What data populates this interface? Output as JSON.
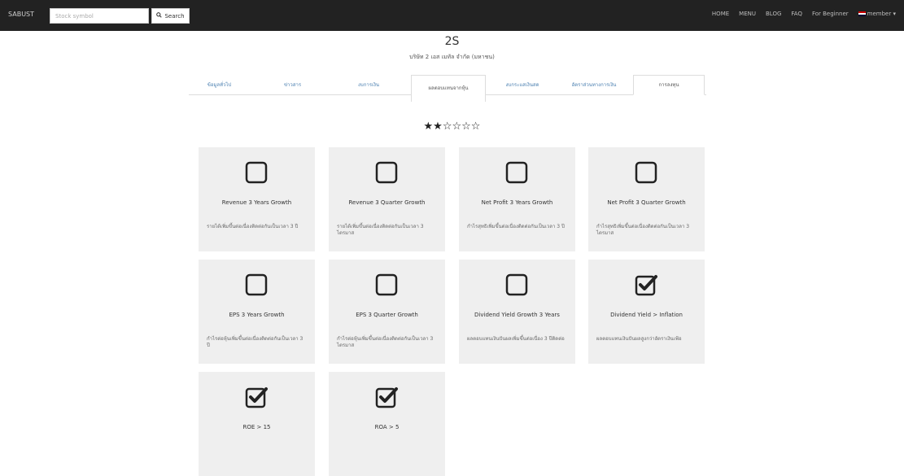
{
  "navbar": {
    "brand": "SABUST",
    "search_placeholder": "Stock symbol",
    "search_label": "Search",
    "links": [
      "HOME",
      "MENU",
      "BLOG",
      "FAQ",
      "For Beginner",
      "member"
    ]
  },
  "stock": {
    "code": "2S",
    "name": "บริษัท 2 เอส เมทัล จำกัด (มหาชน)"
  },
  "tabs": [
    "ข้อมูลทั่วไป",
    "ข่าวสาร",
    "งบการเงิน",
    "ผลตอบแทนจากหุ้น",
    "งบกระแสเงินสด",
    "อัตราส่วนทางการเงิน",
    "การลงทุน"
  ],
  "rating": {
    "filled": 1.5,
    "total": 5,
    "text": "★★☆☆☆☆"
  },
  "criteria": [
    {
      "title": "Revenue 3 Years Growth",
      "desc": "รายได้เพิ่มขึ้นต่อเนื่องติดต่อกันเป็นเวลา 3 ปี",
      "checked": false
    },
    {
      "title": "Revenue 3 Quarter Growth",
      "desc": "รายได้เพิ่มขึ้นต่อเนื่องติดต่อกันเป็นเวลา 3 ไตรมาส",
      "checked": false
    },
    {
      "title": "Net Profit 3 Years Growth",
      "desc": "กำไรสุทธิเพิ่มขึ้นต่อเนื่องติดต่อกันเป็นเวลา 3 ปี",
      "checked": false
    },
    {
      "title": "Net Profit 3 Quarter Growth",
      "desc": "กำไรสุทธิเพิ่มขึ้นต่อเนื่องติดต่อกันเป็นเวลา 3 ไตรมาส",
      "checked": false
    },
    {
      "title": "EPS 3 Years Growth",
      "desc": "กำไรต่อหุ้นเพิ่มขึ้นต่อเนื่องติดต่อกันเป็นเวลา 3 ปี",
      "checked": false
    },
    {
      "title": "EPS 3 Quarter Growth",
      "desc": "กำไรต่อหุ้นเพิ่มขึ้นต่อเนื่องติดต่อกันเป็นเวลา 3 ไตรมาส",
      "checked": false
    },
    {
      "title": "Dividend Yield Growth 3 Years",
      "desc": "ผลตอบแทนเงินปันผลเพิ่มขึ้นต่อเนื่อง 3 ปีติดต่อ",
      "checked": false
    },
    {
      "title": "Dividend Yield > Inflation",
      "desc": "ผลตอบแทนเงินปันผลสูงกว่าอัตราเงินเฟ้อ",
      "checked": true
    },
    {
      "title": "ROE > 15",
      "desc": "",
      "checked": true
    },
    {
      "title": "ROA > 5",
      "desc": "",
      "checked": true
    }
  ]
}
